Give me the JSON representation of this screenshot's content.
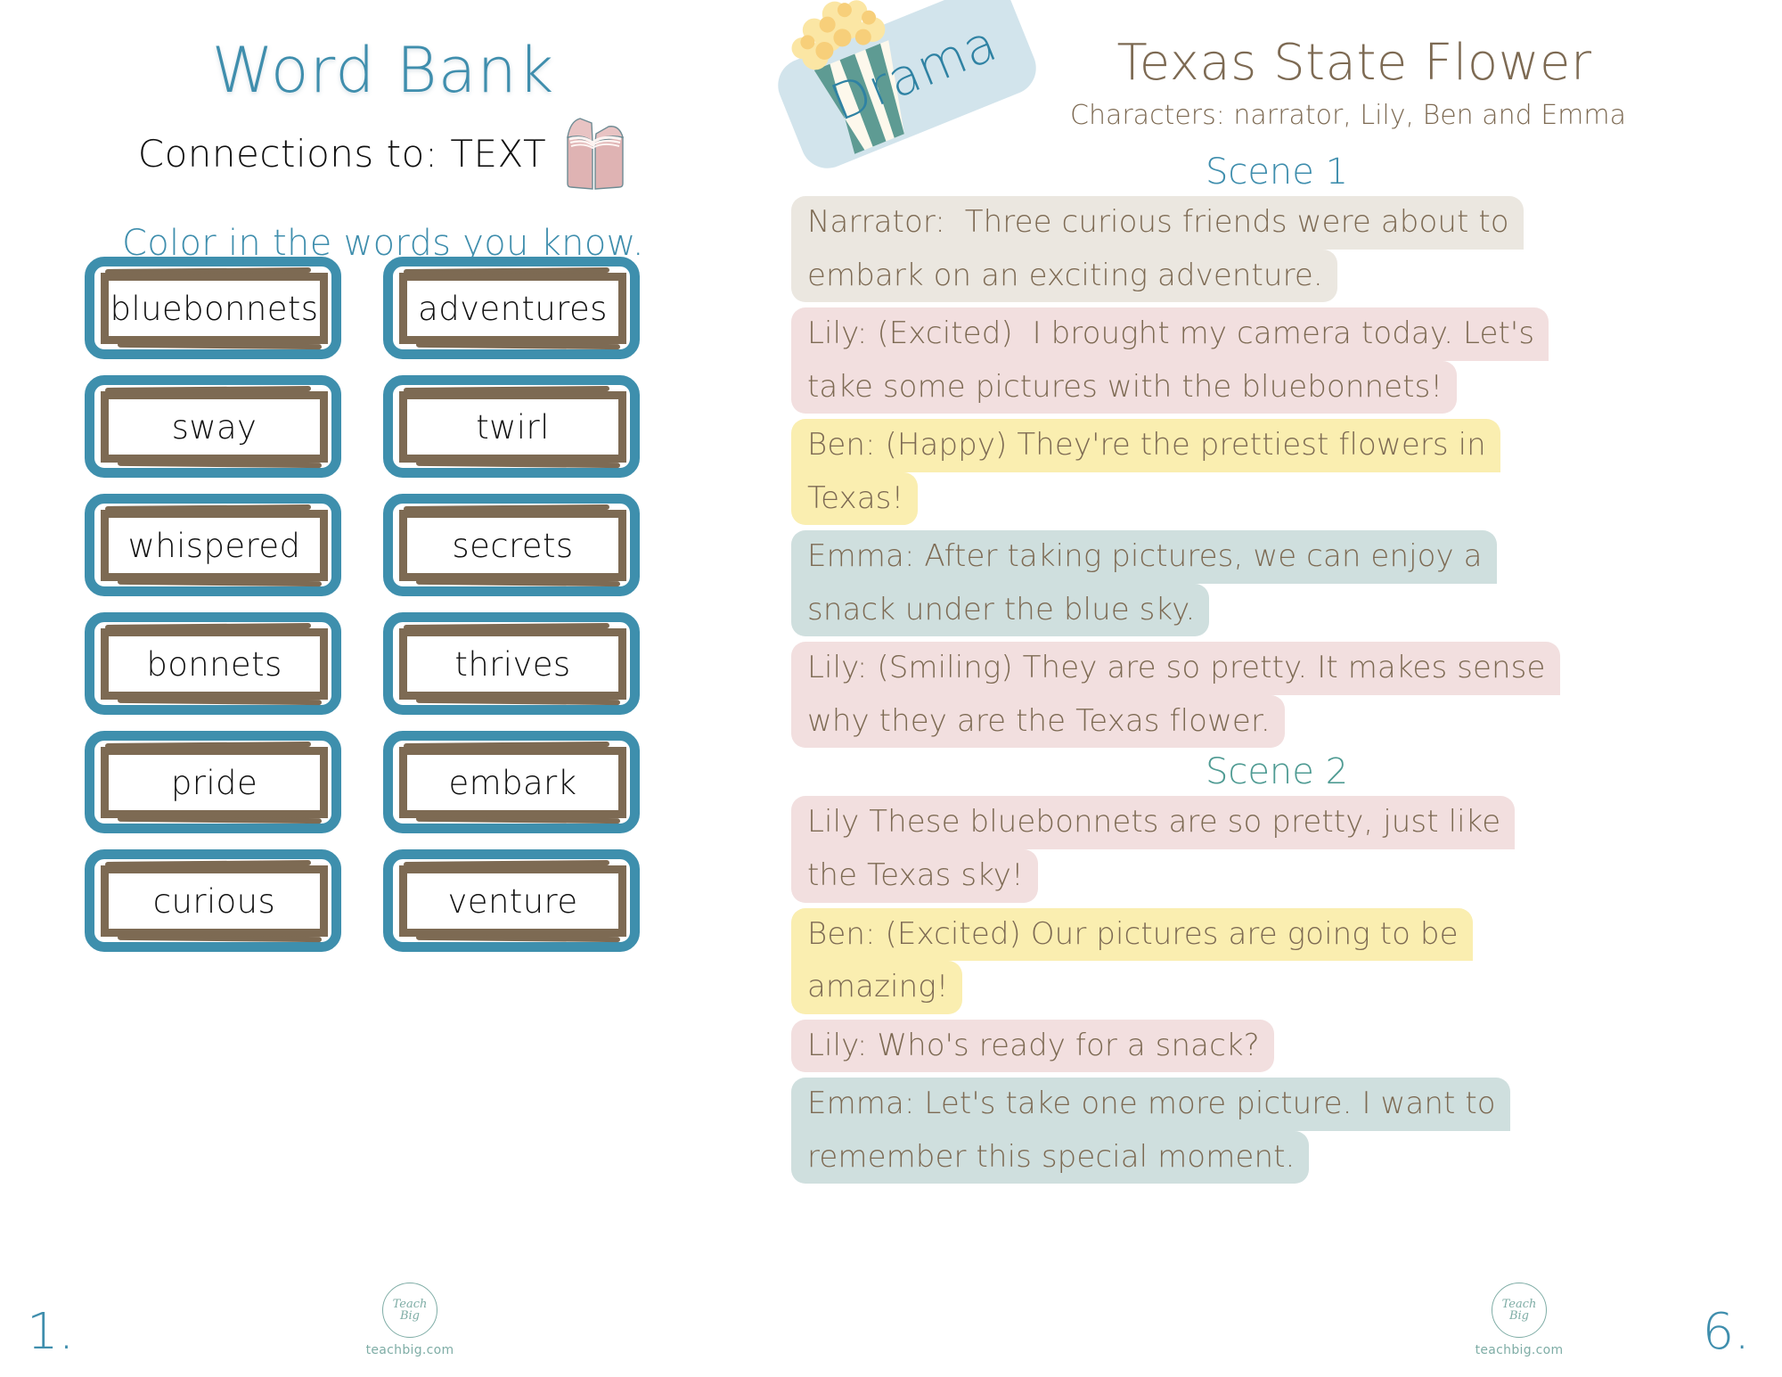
{
  "left_page": {
    "title": "Word Bank",
    "subtitle": "Connections to:  TEXT",
    "instruction": "Color in the words you know.",
    "book_icon": "open-book-icon",
    "page_number": "1.",
    "words": [
      "bluebonnets",
      "adventures",
      "sway",
      "twirl",
      "whispered",
      "secrets",
      "bonnets",
      "thrives",
      "pride",
      "embark",
      "curious",
      "venture"
    ],
    "colors": {
      "title": "#3f8ead",
      "card_outer_border": "#3e8fad",
      "card_inner_border": "#7d6a53",
      "word_text": "#111111"
    }
  },
  "right_page": {
    "genre_badge": "Drama",
    "genre_icon": "popcorn-icon",
    "title": "Texas State Flower",
    "characters": "Characters: narrator, Lily, Ben and Emma",
    "page_number": "6.",
    "colors": {
      "title": "#7d6a53",
      "badge_bg": "#d2e4ec",
      "badge_text": "#2f82a3",
      "scene1": "#3f8ead",
      "scene2": "#4f9b93",
      "hl_narrator": "#ebe7e0",
      "hl_lily": "#f2dfdf",
      "hl_ben": "#faeeb0",
      "hl_emma": "#cfdfde"
    },
    "scenes": [
      {
        "heading": "Scene 1",
        "heading_class": "scene-1",
        "lines": [
          {
            "speaker": "narrator",
            "style": "hl-narrator",
            "text_lines": [
              "Narrator:  Three curious friends were about to",
              "embark on an exciting adventure."
            ]
          },
          {
            "speaker": "lily",
            "style": "hl-lily",
            "text_lines": [
              "Lily: (Excited)  I brought my camera today. Let's",
              "take some pictures with the bluebonnets!"
            ]
          },
          {
            "speaker": "ben",
            "style": "hl-ben",
            "text_lines": [
              "Ben: (Happy) They're the prettiest flowers in",
              "Texas!"
            ]
          },
          {
            "speaker": "emma",
            "style": "hl-emma",
            "text_lines": [
              "Emma: After taking pictures, we can enjoy a",
              "snack under the blue sky."
            ]
          },
          {
            "speaker": "lily",
            "style": "hl-lily",
            "text_lines": [
              "Lily: (Smiling) They are so pretty. It makes sense",
              "why they are the Texas flower."
            ]
          }
        ]
      },
      {
        "heading": "Scene 2",
        "heading_class": "scene-2",
        "lines": [
          {
            "speaker": "lily",
            "style": "hl-lily",
            "text_lines": [
              "Lily These bluebonnets are so pretty, just like",
              "the Texas sky!"
            ]
          },
          {
            "speaker": "ben",
            "style": "hl-ben",
            "text_lines": [
              "Ben: (Excited) Our pictures are going to be",
              "amazing!"
            ]
          },
          {
            "speaker": "lily",
            "style": "hl-lily",
            "text_lines": [
              "Lily: Who's ready for a snack?"
            ]
          },
          {
            "speaker": "emma",
            "style": "hl-emma",
            "text_lines": [
              "Emma: Let's take one more picture. I want to",
              "remember this special moment."
            ]
          }
        ]
      }
    ]
  },
  "brand": {
    "logo_text": "Teach Big",
    "url": "teachbig.com"
  }
}
